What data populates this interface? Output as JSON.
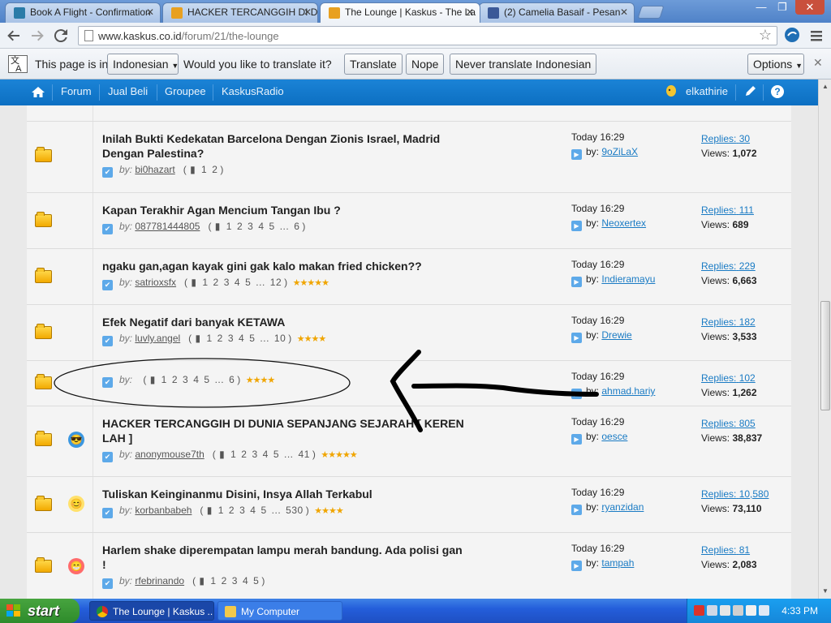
{
  "browser": {
    "tabs": [
      {
        "label": "Book A Flight - Confirmation",
        "favicon": "airline-icon",
        "active": false
      },
      {
        "label": "HACKER TERCANGGIH DI DU",
        "favicon": "kaskus-icon",
        "active": false
      },
      {
        "label": "The Lounge | Kaskus - The La",
        "favicon": "kaskus-icon",
        "active": true
      },
      {
        "label": "(2) Camelia Basaif - Pesan",
        "favicon": "facebook-icon",
        "active": false
      }
    ],
    "url_host": "www.kaskus.co.id",
    "url_path": "/forum/21/the-lounge",
    "window_controls": {
      "minimize": "—",
      "restore": "❐",
      "close": "✕"
    }
  },
  "translate_bar": {
    "prefix": "This page is in",
    "language": "Indonesian",
    "question": "Would you like to translate it?",
    "translate_label": "Translate",
    "nope_label": "Nope",
    "never_label": "Never translate Indonesian",
    "options_label": "Options",
    "close": "✕"
  },
  "site_nav": {
    "home_icon": "home-icon",
    "items": [
      "Forum",
      "Jual Beli",
      "Groupee",
      "KaskusRadio"
    ],
    "username": "elkathirie",
    "help": "?"
  },
  "threads": [
    {
      "title": "Inilah Bukti Kedekatan Barcelona Dengan Zionis Israel, Madrid Dengan Palestina?",
      "emoticon": "",
      "by_label": "by:",
      "author": "bi0hazart",
      "pages": [
        "1",
        "2"
      ],
      "stars": 0,
      "last_time": "Today 16:29",
      "last_by_label": "by:",
      "last_author": "9oZiLaX",
      "replies_label": "Replies:",
      "replies": "30",
      "views_label": "Views:",
      "views": "1,072"
    },
    {
      "title": "Kapan Terakhir Agan Mencium Tangan Ibu ?",
      "emoticon": "",
      "by_label": "by:",
      "author": "087781444805",
      "pages": [
        "1",
        "2",
        "3",
        "4",
        "5",
        "...",
        "6"
      ],
      "stars": 0,
      "last_time": "Today 16:29",
      "last_by_label": "by:",
      "last_author": "Neoxertex",
      "replies_label": "Replies:",
      "replies": "111",
      "views_label": "Views:",
      "views": "689"
    },
    {
      "title": "ngaku gan,agan kayak gini gak kalo makan fried chicken??",
      "emoticon": "",
      "by_label": "by:",
      "author": "satrioxsfx",
      "pages": [
        "1",
        "2",
        "3",
        "4",
        "5",
        "...",
        "12"
      ],
      "stars": 5,
      "last_time": "Today 16:29",
      "last_by_label": "by:",
      "last_author": "Indieramayu",
      "replies_label": "Replies:",
      "replies": "229",
      "views_label": "Views:",
      "views": "6,663"
    },
    {
      "title": "Efek Negatif dari banyak KETAWA",
      "emoticon": "",
      "by_label": "by:",
      "author": "luvly.angel",
      "pages": [
        "1",
        "2",
        "3",
        "4",
        "5",
        "...",
        "10"
      ],
      "stars": 4,
      "last_time": "Today 16:29",
      "last_by_label": "by:",
      "last_author": "Drewie",
      "replies_label": "Replies:",
      "replies": "182",
      "views_label": "Views:",
      "views": "3,533"
    },
    {
      "title": "",
      "emoticon": "",
      "by_label": "by:",
      "author": "",
      "pages": [
        "1",
        "2",
        "3",
        "4",
        "5",
        "...",
        "6"
      ],
      "stars": 4,
      "last_time": "Today 16:29",
      "last_by_label": "by:",
      "last_author": "ahmad.hariy",
      "replies_label": "Replies:",
      "replies": "102",
      "views_label": "Views:",
      "views": "1,262"
    },
    {
      "title": "HACKER TERCANGGIH DI DUNIA SEPANJANG SEJARAH [ KEREN LAH ]",
      "emoticon": "cool-icon",
      "by_label": "by:",
      "author": "anonymouse7th",
      "pages": [
        "1",
        "2",
        "3",
        "4",
        "5",
        "...",
        "41"
      ],
      "stars": 5,
      "last_time": "Today 16:29",
      "last_by_label": "by:",
      "last_author": "oesce",
      "replies_label": "Replies:",
      "replies": "805",
      "views_label": "Views:",
      "views": "38,837"
    },
    {
      "title": "Tuliskan Keinginanmu Disini, Insya Allah Terkabul",
      "emoticon": "smile-icon",
      "by_label": "by:",
      "author": "korbanbabeh",
      "pages": [
        "1",
        "2",
        "3",
        "4",
        "5",
        "...",
        "530"
      ],
      "stars": 4,
      "last_time": "Today 16:29",
      "last_by_label": "by:",
      "last_author": "ryanzidan",
      "replies_label": "Replies:",
      "replies": "10,580",
      "views_label": "Views:",
      "views": "73,110"
    },
    {
      "title": "Harlem shake diperempatan lampu merah bandung. Ada polisi gan !",
      "emoticon": "grin-icon",
      "by_label": "by:",
      "author": "rfebrinando",
      "pages": [
        "1",
        "2",
        "3",
        "4",
        "5"
      ],
      "stars": 0,
      "last_time": "Today 16:29",
      "last_by_label": "by:",
      "last_author": "tampah",
      "replies_label": "Replies:",
      "replies": "81",
      "views_label": "Views:",
      "views": "2,083"
    }
  ],
  "taskbar": {
    "start_label": "start",
    "items": [
      {
        "label": "The Lounge | Kaskus ...",
        "icon": "chrome-icon"
      },
      {
        "label": "My Computer",
        "icon": "folder-icon"
      }
    ],
    "clock": "4:33 PM"
  },
  "colors": {
    "nav_blue": "#1478cc",
    "link_blue": "#1a7bc4",
    "star_gold": "#f0a500",
    "folder_gold": "#f7c52c"
  }
}
